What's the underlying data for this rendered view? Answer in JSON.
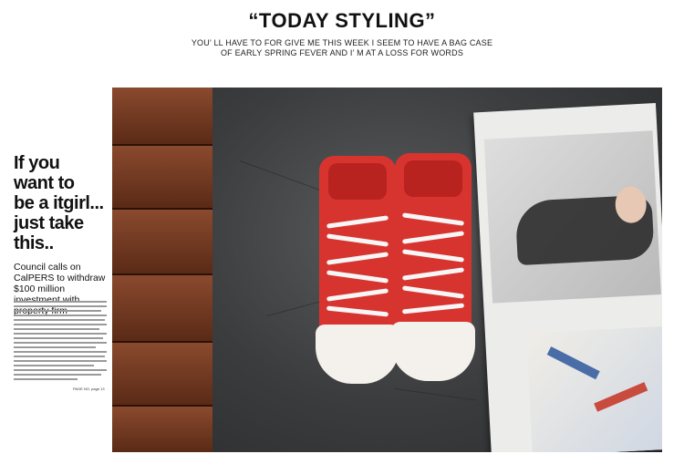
{
  "header": {
    "title": "“TODAY STYLING”",
    "subtitle_line1": "YOU’ LL HAVE TO FOR GIVE ME THIS WEEK I SEEM TO HAVE A BAG CASE",
    "subtitle_line2": "OF EARLY SPRING FEVER AND I’ M AT A LOSS FOR WORDS"
  },
  "article": {
    "headline_lines": [
      "If you",
      "want to",
      "be a itgirl...",
      "just take",
      "this.."
    ],
    "deck": "Council calls on CalPERS to withdraw $100 million investment with property firm",
    "page_ref": "PAGE NO. page 13"
  },
  "colors": {
    "shoe": "#d8342f",
    "sole": "#f4f1ec",
    "wood": "#6e3520",
    "stone": "#3e3f40"
  }
}
